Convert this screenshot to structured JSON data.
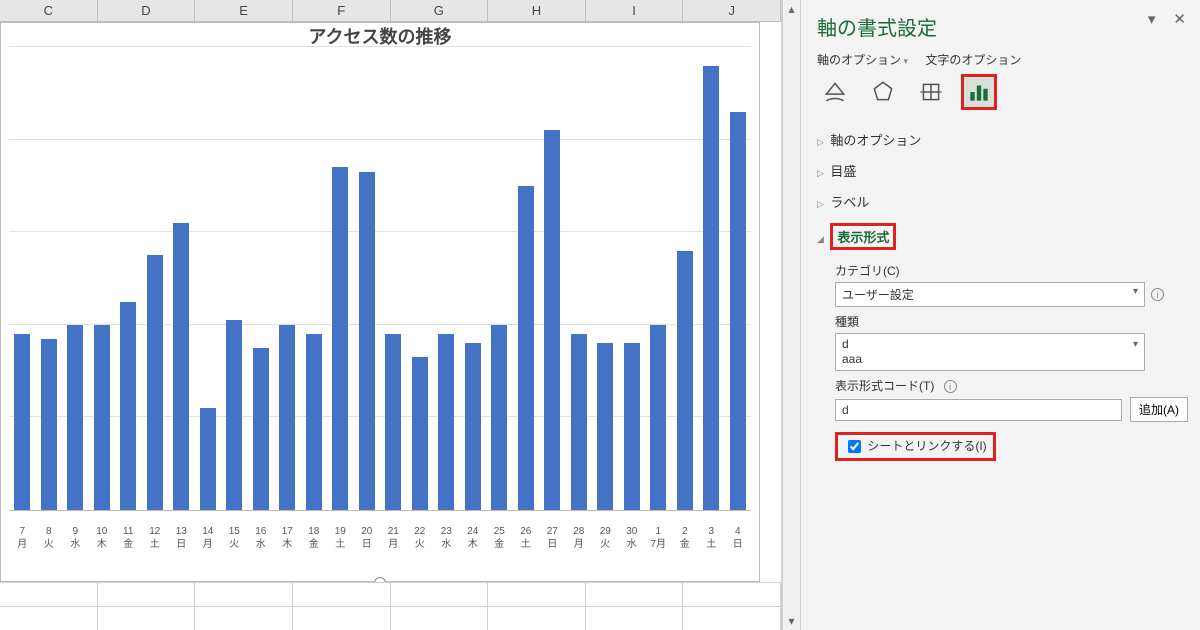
{
  "columns": [
    "C",
    "D",
    "E",
    "F",
    "G",
    "H",
    "I",
    "J"
  ],
  "chart_data": {
    "type": "bar",
    "title": "アクセス数の推移",
    "ylim": [
      0,
      100
    ],
    "categories_day": [
      "7",
      "8",
      "9",
      "10",
      "11",
      "12",
      "13",
      "14",
      "15",
      "16",
      "17",
      "18",
      "19",
      "20",
      "21",
      "22",
      "23",
      "24",
      "25",
      "26",
      "27",
      "28",
      "29",
      "30",
      "1",
      "2",
      "3",
      "4"
    ],
    "categories_wday": [
      "月",
      "火",
      "水",
      "木",
      "金",
      "土",
      "日",
      "月",
      "火",
      "水",
      "木",
      "金",
      "土",
      "日",
      "月",
      "火",
      "水",
      "木",
      "金",
      "土",
      "日",
      "月",
      "火",
      "水",
      "7月",
      "金",
      "土",
      "日"
    ],
    "values": [
      38,
      37,
      40,
      40,
      45,
      55,
      62,
      22,
      41,
      35,
      40,
      38,
      74,
      73,
      38,
      33,
      38,
      36,
      40,
      70,
      82,
      38,
      36,
      36,
      40,
      56,
      96,
      86
    ]
  },
  "pane": {
    "title": "軸の書式設定",
    "tab_axis_options": "軸のオプション",
    "tab_text_options": "文字のオプション",
    "sections": {
      "axis_options": "軸のオプション",
      "tick_marks": "目盛",
      "labels": "ラベル",
      "number_format": "表示形式"
    },
    "form": {
      "category_label": "カテゴリ(C)",
      "category_value": "ユーザー設定",
      "type_label": "種類",
      "type_line1": "d",
      "type_line2": "aaa",
      "code_label": "表示形式コード(T)",
      "code_value": "d",
      "add_button": "追加(A)",
      "link_checkbox": "シートとリンクする(I)"
    }
  }
}
